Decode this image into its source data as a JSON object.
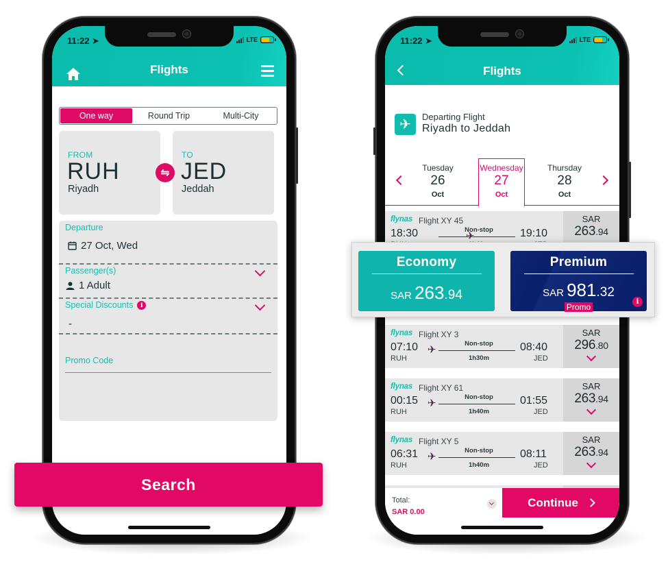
{
  "left_phone": {
    "status": {
      "time": "11:22",
      "network": "LTE"
    },
    "header": {
      "title": "Flights",
      "home_icon": "home-icon",
      "menu_icon": "hamburger-menu-icon"
    },
    "trip_types": [
      {
        "label": "One way",
        "active": true
      },
      {
        "label": "Round Trip",
        "active": false
      },
      {
        "label": "Multi-City",
        "active": false
      }
    ],
    "from": {
      "label": "FROM",
      "code": "RUH",
      "city": "Riyadh"
    },
    "to": {
      "label": "TO",
      "code": "JED",
      "city": "Jeddah"
    },
    "swap_icon": "⇋",
    "departure": {
      "label": "Departure",
      "value": "27 Oct, Wed"
    },
    "passengers": {
      "label": "Passenger(s)",
      "value": "1 Adult"
    },
    "special_discounts": {
      "label": "Special Discounts",
      "value": "-",
      "info": "i"
    },
    "promo_code": {
      "label": "Promo Code",
      "value": ""
    },
    "search_button": "Search"
  },
  "right_phone": {
    "status": {
      "time": "11:22",
      "network": "LTE"
    },
    "header": {
      "title": "Flights"
    },
    "departing": {
      "subtitle": "Departing Flight",
      "route": "Riyadh to Jeddah",
      "icon": "✈"
    },
    "dates": [
      {
        "day": "Tuesday",
        "date": "26",
        "month": "Oct",
        "active": false
      },
      {
        "day": "Wednesday",
        "date": "27",
        "month": "Oct",
        "active": true
      },
      {
        "day": "Thursday",
        "date": "28",
        "month": "Oct",
        "active": false
      }
    ],
    "flights": [
      {
        "airline": "flynas",
        "flight": "Flight XY  45",
        "dep_time": "18:30",
        "dep_code": "RUH",
        "arr_time": "19:10",
        "arr_code": "JED",
        "stops": "Non-stop",
        "duration": "0h40m",
        "currency": "SAR",
        "price_int": "263",
        "price_dec": ".94",
        "expanded": true
      },
      {
        "airline": "flynas",
        "flight": "Flight XY  3",
        "dep_time": "07:10",
        "dep_code": "RUH",
        "arr_time": "08:40",
        "arr_code": "JED",
        "stops": "Non-stop",
        "duration": "1h30m",
        "currency": "SAR",
        "price_int": "296",
        "price_dec": ".80",
        "expanded": false
      },
      {
        "airline": "flynas",
        "flight": "Flight XY  61",
        "dep_time": "00:15",
        "dep_code": "RUH",
        "arr_time": "01:55",
        "arr_code": "JED",
        "stops": "Non-stop",
        "duration": "1h40m",
        "currency": "SAR",
        "price_int": "263",
        "price_dec": ".94",
        "expanded": false
      },
      {
        "airline": "flynas",
        "flight": "Flight XY  5",
        "dep_time": "06:31",
        "dep_code": "RUH",
        "arr_time": "08:11",
        "arr_code": "JED",
        "stops": "Non-stop",
        "duration": "1h40m",
        "currency": "SAR",
        "price_int": "263",
        "price_dec": ".94",
        "expanded": false
      }
    ],
    "fares": [
      {
        "name": "Economy",
        "currency": "SAR",
        "price_int": "263",
        "price_dec": ".94"
      },
      {
        "name": "Premium",
        "currency": "SAR",
        "price_int": "981",
        "price_dec": ".32",
        "tag": "Promo",
        "info": "i"
      }
    ],
    "footer": {
      "total_label": "Total:",
      "total_value": "SAR 0.00",
      "continue": "Continue"
    }
  },
  "colors": {
    "teal": "#0bbbac",
    "pink": "#e10866",
    "navy": "#0b1f6b",
    "card_gray": "#e7e7e7"
  }
}
